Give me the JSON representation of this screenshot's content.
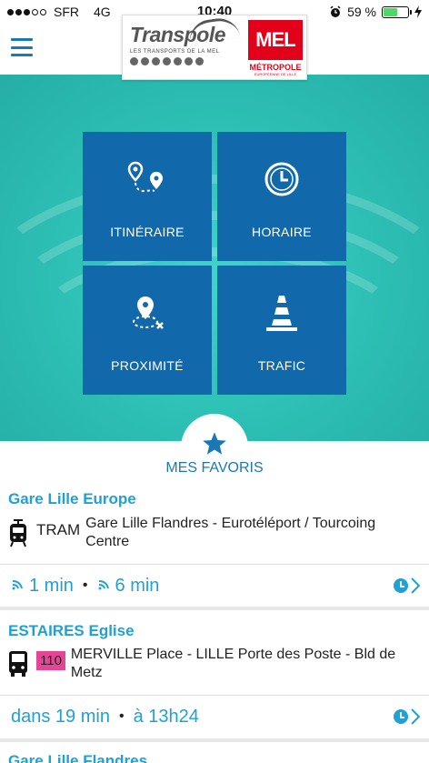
{
  "status_bar": {
    "carrier": "SFR",
    "network": "4G",
    "time": "10:40",
    "battery": "59 %",
    "battery_level": 0.59
  },
  "header": {
    "logo_brand": "Transpole",
    "logo_sub": "LES TRANSPORTS DE LA MEL",
    "mel_mark": "MEL",
    "mel_name": "MÉTROPOLE",
    "mel_sub": "EUROPÉENNE DE LILLE"
  },
  "tiles": [
    {
      "label": "ITINÉRAIRE",
      "icon": "route-pins-icon"
    },
    {
      "label": "HORAIRE",
      "icon": "clock-icon"
    },
    {
      "label": "PROXIMITÉ",
      "icon": "nearby-pin-icon"
    },
    {
      "label": "TRAFIC",
      "icon": "traffic-cone-icon"
    }
  ],
  "favorites": {
    "title": "MES FAVORIS",
    "items": [
      {
        "stop": "Gare Lille Europe",
        "mode": "TRAM",
        "mode_icon": "tram-icon",
        "direction": "Gare Lille Flandres - Eurotéléport / Tourcoing Centre",
        "time1": "1 min",
        "time2": "6 min"
      },
      {
        "stop": "ESTAIRES Eglise",
        "mode_icon": "bus-icon",
        "line_badge": "110",
        "badge_color": "#e64496",
        "direction": "MERVILLE Place - LILLE Porte des Poste - Bld de Metz",
        "time1": "dans 19 min",
        "time2": "à 13h24"
      },
      {
        "stop": "Gare Lille Flandres"
      }
    ]
  },
  "colors": {
    "accent": "#1ea1d8",
    "tile": "#1168aa",
    "hero": "#2fc2b6"
  }
}
